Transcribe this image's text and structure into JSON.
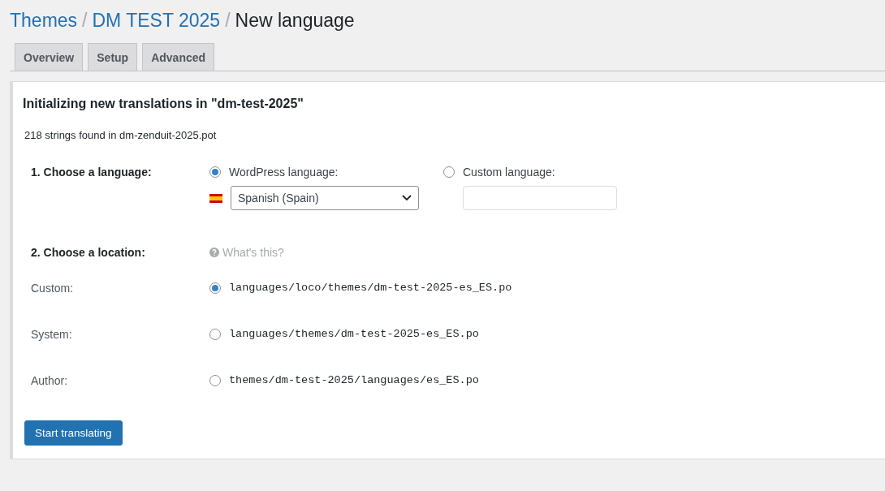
{
  "breadcrumb": [
    {
      "label": "Themes",
      "link": true
    },
    {
      "label": "DM TEST 2025",
      "link": true
    },
    {
      "label": "New language",
      "link": false
    }
  ],
  "breadcrumb_separator": "/",
  "tabs": [
    {
      "label": "Overview",
      "selected": false
    },
    {
      "label": "Setup",
      "selected": false
    },
    {
      "label": "Advanced",
      "selected": false
    }
  ],
  "panel": {
    "title": "Initializing new translations in \"dm-test-2025\"",
    "summary": "218 strings found in dm-zenduit-2025.pot",
    "language": {
      "heading": "1. Choose a language:",
      "options": [
        {
          "kind": "select",
          "label": "WordPress language:",
          "selected": true,
          "value": "Spanish (Spain)"
        },
        {
          "kind": "text",
          "label": "Custom language:",
          "selected": false
        }
      ]
    },
    "location": {
      "heading": "2. Choose a location:",
      "help": "What's this?",
      "options": [
        {
          "label": "Custom:",
          "path": "languages/loco/themes/dm-test-2025-es_ES.po",
          "selected": true
        },
        {
          "label": "System:",
          "path": "languages/themes/dm-test-2025-es_ES.po",
          "selected": false
        },
        {
          "label": "Author:",
          "path": "themes/dm-test-2025/languages/es_ES.po",
          "selected": false
        }
      ]
    },
    "button": "Start translating"
  }
}
